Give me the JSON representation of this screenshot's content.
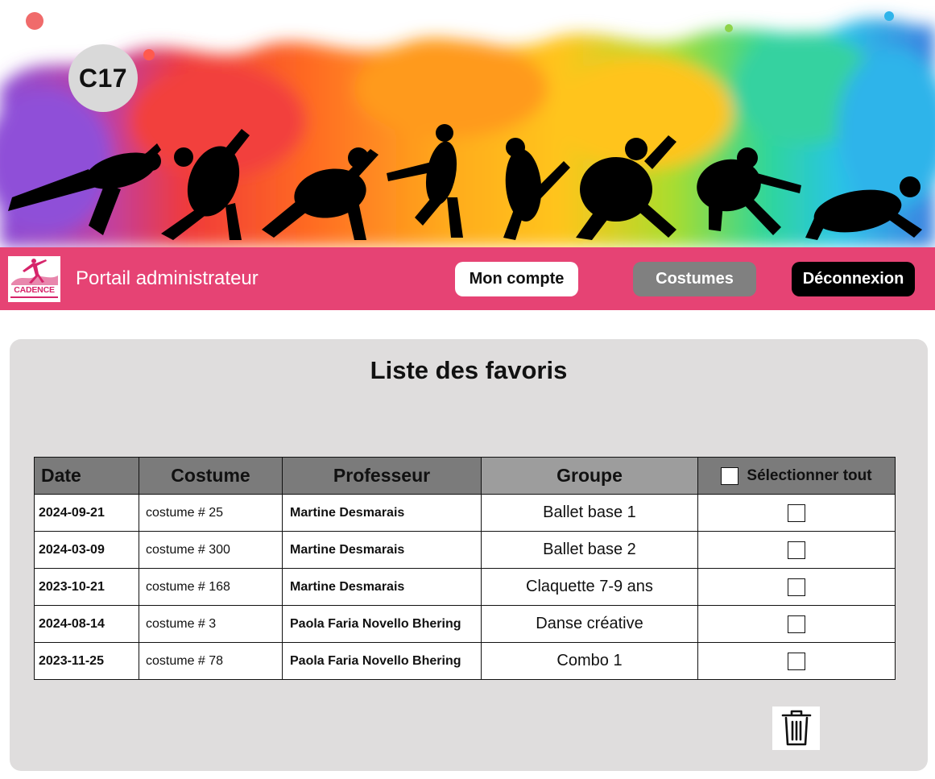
{
  "badge": {
    "label": "C17"
  },
  "nav": {
    "logo_text": "CADENCE",
    "title": "Portail administrateur",
    "account_label": "Mon compte",
    "costumes_label": "Costumes",
    "logout_label": "Déconnexion"
  },
  "favorites": {
    "title": "Liste des favoris",
    "columns": {
      "date": "Date",
      "costume": "Costume",
      "teacher": "Professeur",
      "group": "Groupe",
      "select_all": "Sélectionner tout"
    },
    "rows": [
      {
        "date": "2024-09-21",
        "costume": "costume # 25",
        "teacher": "Martine Desmarais",
        "group": "Ballet base 1",
        "selected": false
      },
      {
        "date": "2024-03-09",
        "costume": "costume # 300",
        "teacher": "Martine Desmarais",
        "group": "Ballet base 2",
        "selected": false
      },
      {
        "date": "2023-10-21",
        "costume": "costume # 168",
        "teacher": "Martine Desmarais",
        "group": "Claquette 7-9 ans",
        "selected": false
      },
      {
        "date": "2024-08-14",
        "costume": "costume # 3",
        "teacher": "Paola Faria Novello Bhering",
        "group": "Danse créative",
        "selected": false
      },
      {
        "date": "2023-11-25",
        "costume": "costume # 78",
        "teacher": "Paola Faria Novello Bhering",
        "group": "Combo 1",
        "selected": false
      }
    ],
    "delete_icon": "trash-icon"
  },
  "colors": {
    "nav_bar": "#e64374",
    "panel": "#dfdddd",
    "header_cell": "#7b7b7b",
    "group_header_cell": "#9d9d9d",
    "costumes_button": "#808080",
    "logout_button": "#000000"
  }
}
